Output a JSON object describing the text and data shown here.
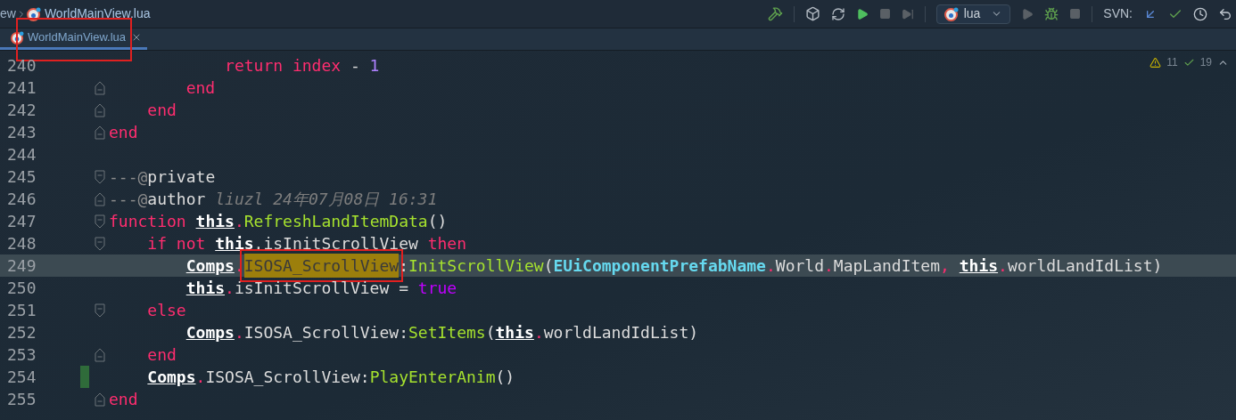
{
  "breadcrumb": {
    "parent": "ew",
    "file": "WorldMainView.lua"
  },
  "toolbar": {
    "config": "lua",
    "svn_label": "SVN:"
  },
  "tabs": [
    {
      "label": "WorldMainView.lua",
      "selected": true,
      "annotated": true
    }
  ],
  "inspections": {
    "warnings": "11",
    "typos": "19"
  },
  "lines": [
    {
      "number": "240",
      "current": false,
      "changed": false,
      "kind": "plain",
      "tokens": [
        {
          "kind": "keyword",
          "text": "            return index"
        },
        {
          "kind": "plain",
          "text": " - "
        },
        {
          "kind": "number",
          "text": "1"
        }
      ]
    },
    {
      "number": "241",
      "current": false,
      "changed": false,
      "kind": "fold_end",
      "tokens": [
        {
          "kind": "keyword",
          "text": "        end"
        }
      ]
    },
    {
      "number": "242",
      "current": false,
      "changed": false,
      "kind": "fold_end",
      "tokens": [
        {
          "kind": "keyword",
          "text": "    end"
        }
      ]
    },
    {
      "number": "243",
      "current": false,
      "changed": false,
      "kind": "fold_end",
      "tokens": [
        {
          "kind": "keyword",
          "text": "end"
        }
      ]
    },
    {
      "number": "244",
      "current": false,
      "changed": false,
      "kind": "plain"
    },
    {
      "number": "245",
      "current": false,
      "changed": false,
      "kind": "fold_start",
      "tokens": [
        {
          "kind": "comment",
          "text": "---@"
        },
        {
          "kind": "plain",
          "text": "private"
        }
      ]
    },
    {
      "number": "246",
      "current": false,
      "changed": false,
      "kind": "fold_end",
      "tokens": [
        {
          "kind": "comment",
          "text": "---@"
        },
        {
          "kind": "plain",
          "text": "author "
        },
        {
          "kind": "meta",
          "text": "liuzl 24年07月08日 16:31"
        }
      ]
    },
    {
      "number": "247",
      "current": false,
      "changed": false,
      "kind": "fold_start",
      "tokens": [
        {
          "kind": "keyword",
          "text": "function "
        },
        {
          "kind": "this",
          "text": "this"
        },
        {
          "kind": "member",
          "text": ".RefreshLandItemData"
        },
        {
          "kind": "plain",
          "text": "()"
        }
      ]
    },
    {
      "number": "248",
      "current": false,
      "changed": false,
      "kind": "fold_start",
      "tokens": [
        {
          "kind": "keyword",
          "text": "    if not "
        },
        {
          "kind": "this",
          "text": "this"
        },
        {
          "kind": "plain",
          "text": ".isInitScrollView "
        },
        {
          "kind": "keyword",
          "text": "then"
        }
      ]
    },
    {
      "number": "249",
      "current": true,
      "changed": false,
      "kind": "plain",
      "tokens": [
        {
          "kind": "this",
          "text": "        Comps"
        },
        {
          "kind": "dot",
          "text": "."
        },
        {
          "kind": "selection",
          "text": "ISOSA_ScrollView",
          "annotated": true
        },
        {
          "kind": "plain",
          "text": ":"
        },
        {
          "kind": "func",
          "text": "InitScrollView"
        },
        {
          "kind": "plain",
          "text": "("
        },
        {
          "kind": "enum",
          "text": "EUiComponentPrefabName"
        },
        {
          "kind": "dot",
          "text": "."
        },
        {
          "kind": "plain",
          "text": "World"
        },
        {
          "kind": "dot",
          "text": "."
        },
        {
          "kind": "plain",
          "text": "MapLandItem"
        },
        {
          "kind": "dot",
          "text": ", "
        },
        {
          "kind": "this",
          "text": "this"
        },
        {
          "kind": "dot",
          "text": "."
        },
        {
          "kind": "plain",
          "text": "worldLandIdList)"
        }
      ]
    },
    {
      "number": "250",
      "current": false,
      "changed": false,
      "kind": "plain",
      "tokens": [
        {
          "kind": "this",
          "text": "        this"
        },
        {
          "kind": "dot",
          "text": "."
        },
        {
          "kind": "plain",
          "text": "isInitScrollView = "
        },
        {
          "kind": "bool",
          "text": "true"
        }
      ]
    },
    {
      "number": "251",
      "current": false,
      "changed": false,
      "kind": "fold_start",
      "tokens": [
        {
          "kind": "keyword",
          "text": "    else"
        }
      ]
    },
    {
      "number": "252",
      "current": false,
      "changed": false,
      "kind": "plain",
      "tokens": [
        {
          "kind": "this",
          "text": "        Comps"
        },
        {
          "kind": "dot",
          "text": "."
        },
        {
          "kind": "plain",
          "text": "ISOSA_ScrollView:"
        },
        {
          "kind": "func",
          "text": "SetItems"
        },
        {
          "kind": "plain",
          "text": "("
        },
        {
          "kind": "this",
          "text": "this"
        },
        {
          "kind": "dot",
          "text": "."
        },
        {
          "kind": "plain",
          "text": "worldLandIdList)"
        }
      ]
    },
    {
      "number": "253",
      "current": false,
      "changed": false,
      "kind": "fold_end",
      "tokens": [
        {
          "kind": "keyword",
          "text": "    end"
        }
      ]
    },
    {
      "number": "254",
      "current": false,
      "changed": true,
      "kind": "plain",
      "tokens": [
        {
          "kind": "this",
          "text": "    Comps"
        },
        {
          "kind": "dot",
          "text": "."
        },
        {
          "kind": "plain",
          "text": "ISOSA_ScrollView:"
        },
        {
          "kind": "func",
          "text": "PlayEnterAnim"
        },
        {
          "kind": "plain",
          "text": "()"
        }
      ]
    },
    {
      "number": "255",
      "current": false,
      "changed": false,
      "kind": "fold_end",
      "tokens": [
        {
          "kind": "keyword",
          "text": "end"
        }
      ]
    }
  ]
}
